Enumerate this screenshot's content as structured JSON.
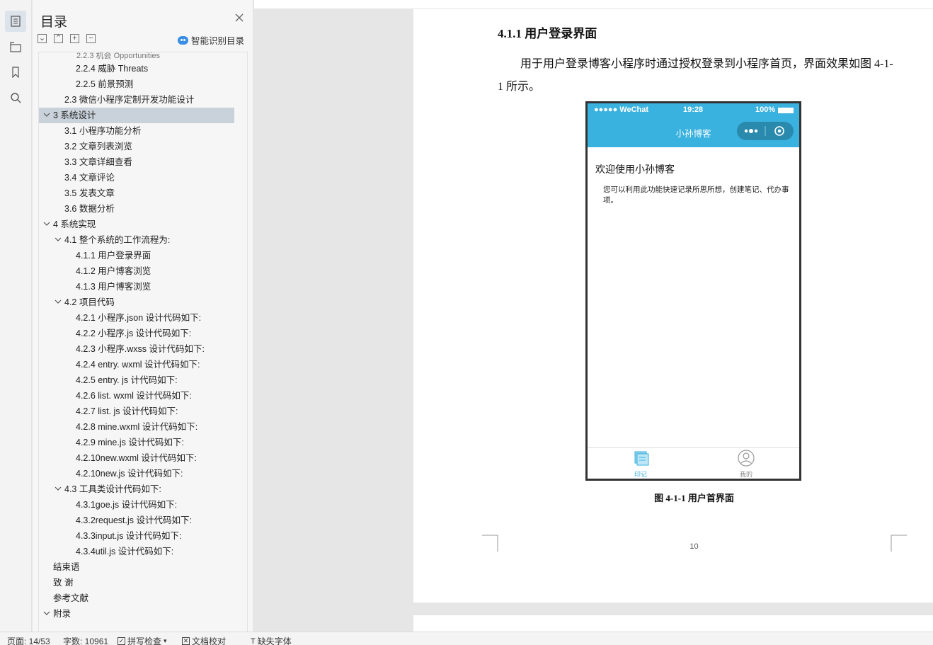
{
  "toc": {
    "title": "目录",
    "smart_label": "智能识别目录",
    "items": [
      {
        "label": "2.2.4  威胁 Threats",
        "indent": 3
      },
      {
        "label": "2.2.5  前景预测",
        "indent": 3
      },
      {
        "label": "2.3    微信小程序定制开发功能设计",
        "indent": 2
      },
      {
        "label": "3  系统设计",
        "indent": 1,
        "expanded": true,
        "selected": true
      },
      {
        "label": "3.1 小程序功能分析",
        "indent": 2
      },
      {
        "label": "3.2 文章列表浏览",
        "indent": 2
      },
      {
        "label": "3.3 文章详细查看",
        "indent": 2
      },
      {
        "label": "3.4 文章评论",
        "indent": 2
      },
      {
        "label": "3.5 发表文章",
        "indent": 2
      },
      {
        "label": "3.6 数据分析",
        "indent": 2
      },
      {
        "label": "4  系统实现",
        "indent": 1,
        "expanded": true
      },
      {
        "label": "4.1 整个系统的工作流程为:",
        "indent": 2,
        "expanded": true
      },
      {
        "label": "4.1.1  用户登录界面",
        "indent": 3
      },
      {
        "label": "4.1.2  用户博客浏览",
        "indent": 3
      },
      {
        "label": "4.1.3  用户博客浏览",
        "indent": 3
      },
      {
        "label": "4.2 项目代码",
        "indent": 2,
        "expanded": true
      },
      {
        "label": "4.2.1 小程序.json 设计代码如下:",
        "indent": 3
      },
      {
        "label": "4.2.2  小程序.js 设计代码如下:",
        "indent": 3
      },
      {
        "label": "4.2.3  小程序.wxss 设计代码如下:",
        "indent": 3
      },
      {
        "label": "4.2.4 entry. wxml 设计代码如下:",
        "indent": 3
      },
      {
        "label": "4.2.5 entry. js 计代码如下:",
        "indent": 3
      },
      {
        "label": "4.2.6 list. wxml 设计代码如下:",
        "indent": 3
      },
      {
        "label": "4.2.7 list. js 设计代码如下:",
        "indent": 3
      },
      {
        "label": "4.2.8 mine.wxml 设计代码如下:",
        "indent": 3
      },
      {
        "label": "4.2.9 mine.js 设计代码如下:",
        "indent": 3
      },
      {
        "label": "4.2.10new.wxml 设计代码如下:",
        "indent": 3
      },
      {
        "label": "4.2.10new.js 设计代码如下:",
        "indent": 3
      },
      {
        "label": "4.3 工具类设计代码如下:",
        "indent": 2,
        "expanded": true
      },
      {
        "label": "4.3.1goe.js 设计代码如下:",
        "indent": 3
      },
      {
        "label": "4.3.2request.js 设计代码如下:",
        "indent": 3
      },
      {
        "label": "4.3.3input.js 设计代码如下:",
        "indent": 3
      },
      {
        "label": "4.3.4util.js 设计代码如下:",
        "indent": 3
      },
      {
        "label": "结束语",
        "indent": 1
      },
      {
        "label": "致    谢",
        "indent": 1
      },
      {
        "label": "参考文献",
        "indent": 1
      },
      {
        "label": "附录",
        "indent": 1,
        "expanded": true
      }
    ]
  },
  "doc": {
    "heading": "4.1.1  用户登录界面",
    "paragraph": "用于用户登录博客小程序时通过授权登录到小程序首页，界面效果如图 4-1-1 所示。",
    "caption": "图 4-1-1  用户首界面",
    "page_number": "10"
  },
  "phone": {
    "carrier": "●●●●● WeChat",
    "time": "19:28",
    "battery": "100%",
    "nav_title": "小孙博客",
    "welcome": "欢迎使用小孙博客",
    "desc": "您可以利用此功能快速记录所思所想，创建笔记、代办事项。",
    "tab_left": "印记",
    "tab_right": "我的"
  },
  "statusbar": {
    "page": "页面: 14/53",
    "words": "字数: 10961",
    "spell": "拼写检查",
    "proof": "文档校对",
    "missing_font": "缺失字体"
  },
  "colors": {
    "accent": "#3ab2df",
    "selection": "#c9d1da"
  }
}
